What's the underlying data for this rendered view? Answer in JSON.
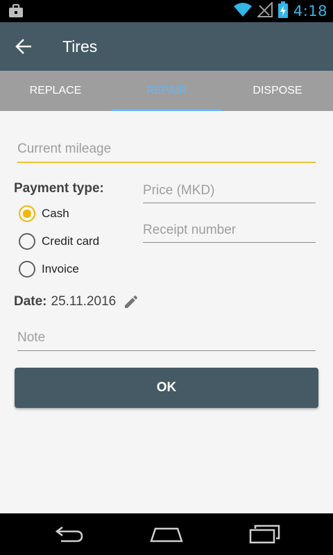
{
  "status_bar": {
    "time": "4:18",
    "icons": [
      "briefcase-notification-icon",
      "wifi-icon",
      "signal-icon",
      "battery-charging-icon"
    ]
  },
  "app_bar": {
    "title": "Tires",
    "back_icon": "arrow-back-icon"
  },
  "tabs": [
    {
      "label": "REPLACE",
      "active": false
    },
    {
      "label": "REPAIR",
      "active": true
    },
    {
      "label": "DISPOSE",
      "active": false
    }
  ],
  "form": {
    "mileage_placeholder": "Current mileage",
    "payment_type_label": "Payment type:",
    "payment_options": [
      {
        "label": "Cash",
        "checked": true
      },
      {
        "label": "Credit card",
        "checked": false
      },
      {
        "label": "Invoice",
        "checked": false
      }
    ],
    "price_placeholder": "Price (MKD)",
    "receipt_placeholder": "Receipt number",
    "date_label": "Date:",
    "date_value": "25.11.2016",
    "note_placeholder": "Note",
    "ok_label": "OK"
  },
  "nav_bar": {
    "icons": [
      "nav-back-icon",
      "nav-home-icon",
      "nav-recents-icon"
    ]
  },
  "colors": {
    "primary": "#455a64",
    "accent": "#f2b705",
    "tab_active": "#64b5f6",
    "tab_bar": "#9e9e9e"
  }
}
